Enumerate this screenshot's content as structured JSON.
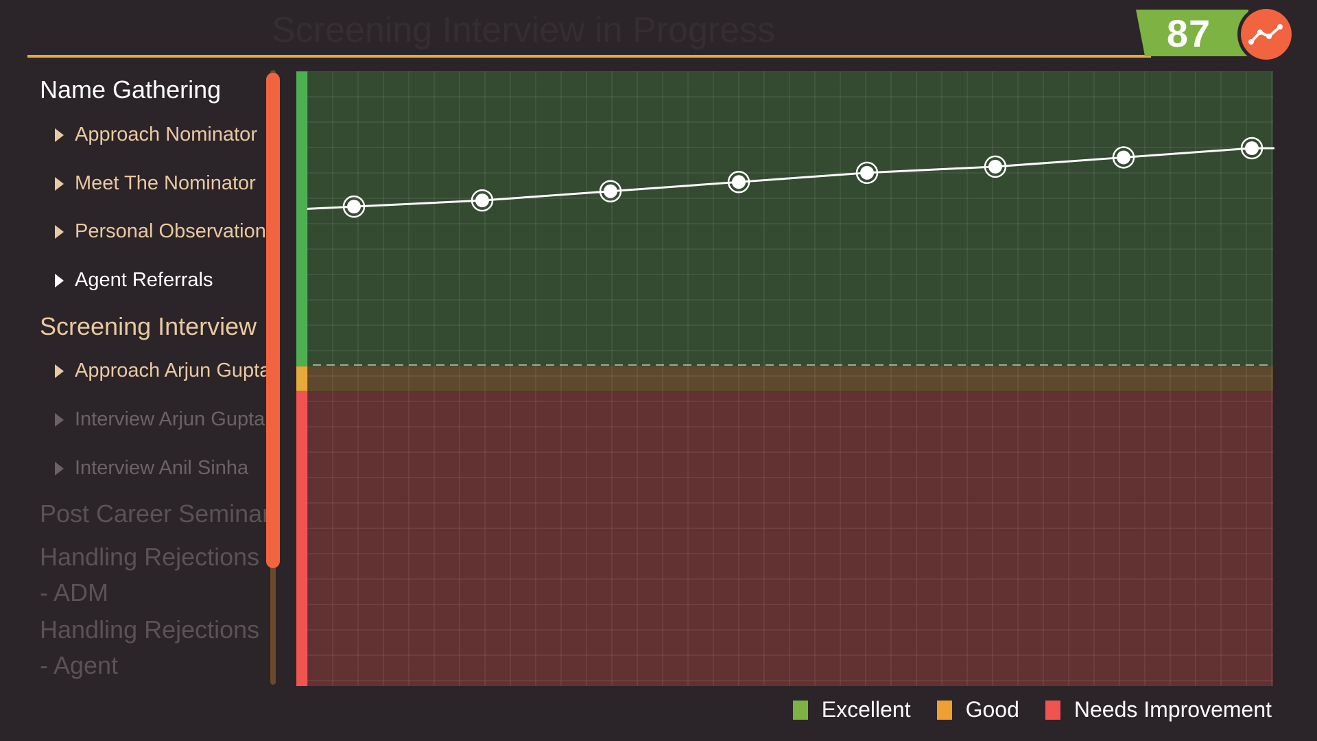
{
  "header": {
    "title": "Screening Interview in Progress",
    "score": "87",
    "trend_icon": "trend-line-icon",
    "accent_color": "#e6a93a"
  },
  "sidebar": {
    "items": [
      {
        "type": "section",
        "label": "Name Gathering",
        "state": "active"
      },
      {
        "type": "sub",
        "label": "Approach Nominator",
        "state": "done"
      },
      {
        "type": "sub",
        "label": "Meet The Nominator",
        "state": "done"
      },
      {
        "type": "sub",
        "label": "Personal Observation",
        "state": "done"
      },
      {
        "type": "sub",
        "label": "Agent Referrals",
        "state": "active"
      },
      {
        "type": "section",
        "label": "Screening Interview",
        "state": "done"
      },
      {
        "type": "sub",
        "label": "Approach Arjun Gupta",
        "state": "done"
      },
      {
        "type": "sub",
        "label": "Interview Arjun Gupta",
        "state": "locked"
      },
      {
        "type": "sub",
        "label": "Interview Anil Sinha",
        "state": "locked"
      },
      {
        "type": "section",
        "label": "Post Career Seminar",
        "state": "locked"
      },
      {
        "type": "section",
        "label": "Handling Rejections - ADM",
        "state": "locked"
      },
      {
        "type": "section",
        "label": "Handling Rejections - Agent",
        "state": "locked"
      }
    ]
  },
  "chart_data": {
    "type": "line",
    "bands": [
      {
        "name": "Excellent",
        "from": 0,
        "to": 0.48,
        "color": "#4caf50"
      },
      {
        "name": "Good",
        "from": 0.48,
        "to": 0.52,
        "color": "#e6a93a"
      },
      {
        "name": "Needs Improvement",
        "from": 0.52,
        "to": 1.0,
        "color": "#f05350"
      }
    ],
    "series": [
      {
        "values": [
          78,
          79,
          80.5,
          82,
          83.5,
          84.5,
          86,
          87.5
        ]
      }
    ],
    "ylim": [
      0,
      100
    ],
    "threshold": 50,
    "grid": true,
    "legend_position": "bottom-right"
  },
  "legend": {
    "items": [
      {
        "label": "Excellent",
        "color": "#7cb342"
      },
      {
        "label": "Good",
        "color": "#f0a030"
      },
      {
        "label": "Needs Improvement",
        "color": "#f05350"
      }
    ]
  }
}
